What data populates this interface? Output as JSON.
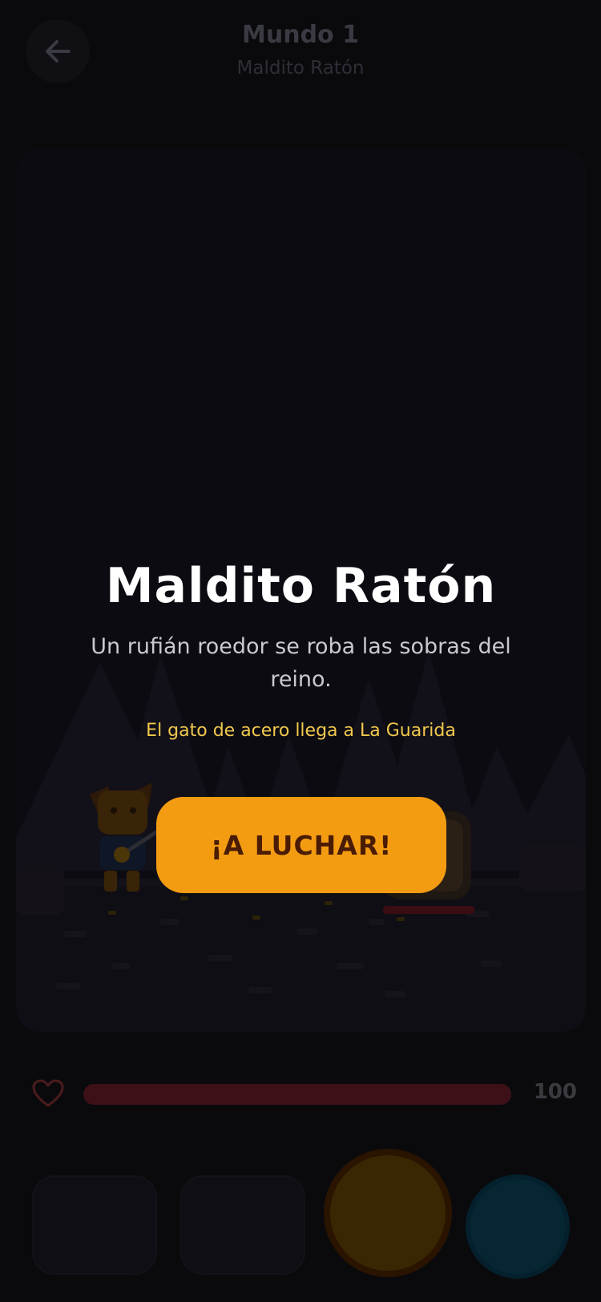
{
  "header": {
    "title": "Mundo 1",
    "subtitle": "Maldito Ratón"
  },
  "intro": {
    "title": "Maldito Ratón",
    "description": "Un rufián roedor se roba las sobras del reino.",
    "caption": "El gato de acero llega a La Guarida",
    "cta_label": "¡A LUCHAR!"
  },
  "player": {
    "health": 100,
    "health_fraction": 1.0
  },
  "icons": {
    "back": "arrow-left-icon",
    "health": "heart-icon"
  },
  "colors": {
    "accent": "#f39c12",
    "caption": "#f1c94d",
    "health": "#3d1018",
    "special": "#062633"
  }
}
